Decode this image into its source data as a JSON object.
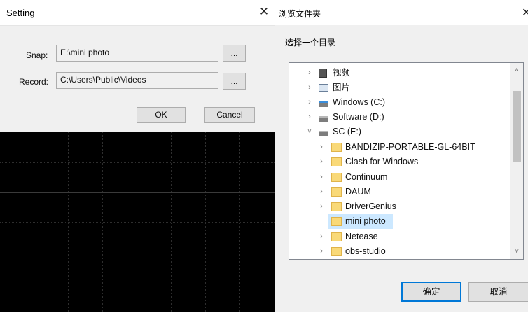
{
  "setting": {
    "title": "Setting",
    "close": "✕",
    "snap_label": "Snap:",
    "snap_value": "E:\\mini photo",
    "record_label": "Record:",
    "record_value": "C:\\Users\\Public\\Videos",
    "browse_label": "...",
    "ok_label": "OK",
    "cancel_label": "Cancel"
  },
  "browse": {
    "title": "浏览文件夹",
    "close": "✕",
    "prompt": "选择一个目录",
    "tree": [
      {
        "label": "视频",
        "icon": "video-folder-icon",
        "chevron": "›"
      },
      {
        "label": "图片",
        "icon": "picture-folder-icon",
        "chevron": "›"
      },
      {
        "label": "Windows (C:)",
        "icon": "windows-drive-icon",
        "chevron": "›"
      },
      {
        "label": "Software (D:)",
        "icon": "drive-icon",
        "chevron": "›"
      },
      {
        "label": "SC (E:)",
        "icon": "drive-icon",
        "chevron": "˅"
      },
      {
        "label": "BANDIZIP-PORTABLE-GL-64BIT",
        "icon": "folder-icon",
        "chevron": "›"
      },
      {
        "label": "Clash for Windows",
        "icon": "folder-icon",
        "chevron": "›"
      },
      {
        "label": "Continuum",
        "icon": "folder-icon",
        "chevron": "›"
      },
      {
        "label": "DAUM",
        "icon": "folder-icon",
        "chevron": "›"
      },
      {
        "label": "DriverGenius",
        "icon": "folder-icon",
        "chevron": "›"
      },
      {
        "label": "mini photo",
        "icon": "folder-icon",
        "chevron": "",
        "selected": true
      },
      {
        "label": "Netease",
        "icon": "folder-icon",
        "chevron": "›"
      },
      {
        "label": "obs-studio",
        "icon": "folder-icon",
        "chevron": "›"
      }
    ],
    "scroll_up": "˄",
    "scroll_down": "˅",
    "ok_label": "确定",
    "cancel_label": "取消",
    "accent": "#0078d7",
    "selection_color": "#cce8ff"
  }
}
